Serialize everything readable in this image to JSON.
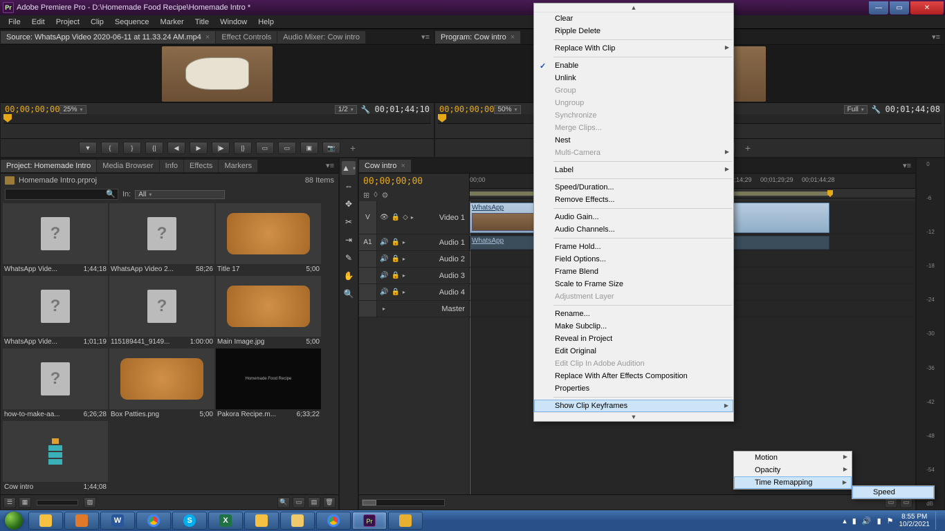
{
  "window": {
    "title": "Adobe Premiere Pro - D:\\Homemade Food Recipe\\Homemade Intro *",
    "app_abbrev": "Pr"
  },
  "menu": [
    "File",
    "Edit",
    "Project",
    "Clip",
    "Sequence",
    "Marker",
    "Title",
    "Window",
    "Help"
  ],
  "source_panel": {
    "tabs": [
      "Source: WhatsApp Video 2020-06-11 at 11.33.24 AM.mp4",
      "Effect Controls",
      "Audio Mixer: Cow intro"
    ],
    "tc_in": "00;00;00;00",
    "zoom": "25%",
    "fit": "1/2",
    "tc_out": "00;01;44;10"
  },
  "program_panel": {
    "tab": "Program: Cow intro",
    "tc_in": "00;00;00;00",
    "zoom": "50%",
    "quality": "Full",
    "tc_out": "00;01;44;08"
  },
  "project_panel": {
    "tabs": [
      "Project: Homemade Intro",
      "Media Browser",
      "Info",
      "Effects",
      "Markers"
    ],
    "bin": "Homemade Intro.prproj",
    "items_label": "88 Items",
    "search_placeholder": "",
    "in_label": "In:",
    "in_filter": "All",
    "items": [
      {
        "name": "WhatsApp Vide...",
        "dur": "1;44;18",
        "kind": "q"
      },
      {
        "name": "WhatsApp Video 2...",
        "dur": "58;26",
        "kind": "q"
      },
      {
        "name": "Title 17",
        "dur": "5;00",
        "kind": "food"
      },
      {
        "name": "WhatsApp Vide...",
        "dur": "1;01;19",
        "kind": "q"
      },
      {
        "name": "115189441_9149...",
        "dur": "1:00:00",
        "kind": "q"
      },
      {
        "name": "Main Image.jpg",
        "dur": "5;00",
        "kind": "food"
      },
      {
        "name": "how-to-make-aa...",
        "dur": "6;26;28",
        "kind": "q"
      },
      {
        "name": "Box Patties.png",
        "dur": "5;00",
        "kind": "food"
      },
      {
        "name": "Pakora Recipe.m...",
        "dur": "6;33;22",
        "kind": "black"
      },
      {
        "name": "Cow intro",
        "dur": "1;44;08",
        "kind": "seq"
      }
    ]
  },
  "tools": [
    "▲",
    "⇔",
    "✥",
    "✂",
    "⇥",
    "✎",
    "✋",
    "🔍"
  ],
  "timeline": {
    "tab": "Cow intro",
    "tc": "00;00;00;00",
    "ruler": [
      "00;00",
      "00;01;14;29",
      "00;01;29;29",
      "00;01;44;28"
    ],
    "track_v_label": "Video 1",
    "tracks_audio": [
      "Audio 1",
      "Audio 2",
      "Audio 3",
      "Audio 4"
    ],
    "master": "Master",
    "clip_v": "WhatsApp",
    "clip_v_fx": "y ▾",
    "clip_a": "WhatsApp",
    "a_target": "A1",
    "v_target": "V"
  },
  "meters": [
    "0",
    "-6",
    "-12",
    "-18",
    "-24",
    "-30",
    "-36",
    "-42",
    "-48",
    "-54",
    "dB"
  ],
  "ctx_main": [
    {
      "t": "Clear"
    },
    {
      "t": "Ripple Delete"
    },
    {
      "sep": true
    },
    {
      "t": "Replace With Clip",
      "sub": true
    },
    {
      "sep": true
    },
    {
      "t": "Enable",
      "chk": true
    },
    {
      "t": "Unlink"
    },
    {
      "t": "Group",
      "dis": true
    },
    {
      "t": "Ungroup",
      "dis": true
    },
    {
      "t": "Synchronize",
      "dis": true
    },
    {
      "t": "Merge Clips...",
      "dis": true
    },
    {
      "t": "Nest"
    },
    {
      "t": "Multi-Camera",
      "sub": true,
      "dis": true
    },
    {
      "sep": true
    },
    {
      "t": "Label",
      "sub": true
    },
    {
      "sep": true
    },
    {
      "t": "Speed/Duration..."
    },
    {
      "t": "Remove Effects..."
    },
    {
      "sep": true
    },
    {
      "t": "Audio Gain..."
    },
    {
      "t": "Audio Channels..."
    },
    {
      "sep": true
    },
    {
      "t": "Frame Hold..."
    },
    {
      "t": "Field Options..."
    },
    {
      "t": "Frame Blend"
    },
    {
      "t": "Scale to Frame Size"
    },
    {
      "t": "Adjustment Layer",
      "dis": true
    },
    {
      "sep": true
    },
    {
      "t": "Rename..."
    },
    {
      "t": "Make Subclip..."
    },
    {
      "t": "Reveal in Project"
    },
    {
      "t": "Edit Original"
    },
    {
      "t": "Edit Clip In Adobe Audition",
      "dis": true
    },
    {
      "t": "Replace With After Effects Composition"
    },
    {
      "t": "Properties"
    },
    {
      "sep": true
    },
    {
      "t": "Show Clip Keyframes",
      "sub": true,
      "hover": true
    }
  ],
  "ctx_sub1": [
    {
      "t": "Motion",
      "sub": true
    },
    {
      "t": "Opacity",
      "sub": true
    },
    {
      "t": "Time Remapping",
      "sub": true,
      "hover": true
    }
  ],
  "ctx_sub2": [
    {
      "t": "Speed",
      "hover": true
    }
  ],
  "taskbar": {
    "apps": [
      "explorer",
      "media",
      "word",
      "chrome",
      "skype",
      "excel",
      "files",
      "notes",
      "chrome2",
      "premiere",
      "paint"
    ],
    "time": "8:55 PM",
    "date": "10/2/2021"
  }
}
